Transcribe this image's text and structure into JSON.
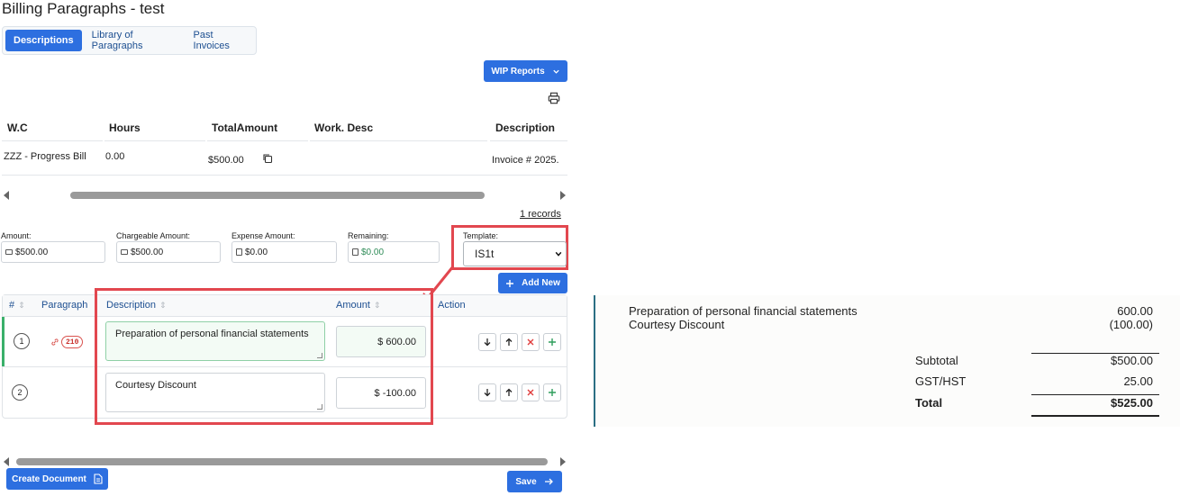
{
  "page": {
    "title": "Billing Paragraphs - test"
  },
  "tabs": [
    {
      "label": "Descriptions",
      "active": true
    },
    {
      "label": "Library of Paragraphs",
      "active": false
    },
    {
      "label": "Past Invoices",
      "active": false
    }
  ],
  "wip": {
    "label": "WIP Reports",
    "icon": "chevron-down-icon"
  },
  "top_table": {
    "columns": [
      "W.C",
      "Hours",
      "TotalAmount",
      "Work. Desc",
      "Description"
    ],
    "row": {
      "wc": "ZZZ - Progress Bill",
      "hours": "0.00",
      "total_amount": "$500.00",
      "work_desc": "",
      "description": "Invoice # 2025."
    },
    "records": "1 records"
  },
  "amounts": {
    "amount": {
      "label": "Amount:",
      "value": "$500.00"
    },
    "chargeable": {
      "label": "Chargeable Amount:",
      "value": "$500.00"
    },
    "expense": {
      "label": "Expense Amount:",
      "value": "$0.00"
    },
    "remaining": {
      "label": "Remaining:",
      "value": "$0.00"
    }
  },
  "template": {
    "label": "Template:",
    "value": "IS1t"
  },
  "add_new": {
    "label": "Add New"
  },
  "grid": {
    "columns": {
      "num": "#",
      "paragraph": "Paragraph",
      "description": "Description",
      "amount": "Amount",
      "action": "Action"
    },
    "rows": [
      {
        "num": "1",
        "badge": "210",
        "description": "Preparation of personal financial statements",
        "amount": "$ 600.00"
      },
      {
        "num": "2",
        "badge": "",
        "description": "Courtesy Discount",
        "amount": "$ -100.00"
      }
    ]
  },
  "buttons": {
    "create_document": "Create Document",
    "save": "Save"
  },
  "preview": {
    "lines": [
      {
        "text": "Preparation of personal financial statements",
        "amount": "600.00"
      },
      {
        "text": "Courtesy Discount",
        "amount": "(100.00)"
      }
    ],
    "subtotal": {
      "label": "Subtotal",
      "value": "$500.00"
    },
    "tax": {
      "label": "GST/HST",
      "value": "25.00"
    },
    "total": {
      "label": "Total",
      "value": "$525.00"
    }
  },
  "colors": {
    "primary": "#2d6fe0",
    "highlight": "#e2474f",
    "success": "#3ab06a",
    "accent_line": "#2b6f83"
  }
}
